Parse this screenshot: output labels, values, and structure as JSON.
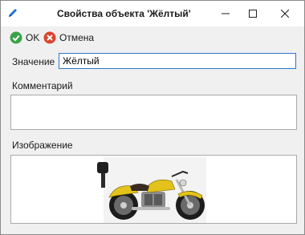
{
  "window": {
    "title": "Свойства объекта 'Жёлтый'",
    "icon": "app-pen-icon"
  },
  "toolbar": {
    "ok_label": "OK",
    "cancel_label": "Отмена"
  },
  "form": {
    "value_label": "Значение",
    "value": "Жёлтый",
    "comment_label": "Комментарий",
    "comment_value": "",
    "image_label": "Изображение",
    "image_subject": "motorcycle-image"
  },
  "colors": {
    "accent": "#2b78d0",
    "ok_green": "#3aa34a",
    "cancel_red": "#d9452f",
    "bike_yellow": "#e3c21c"
  }
}
